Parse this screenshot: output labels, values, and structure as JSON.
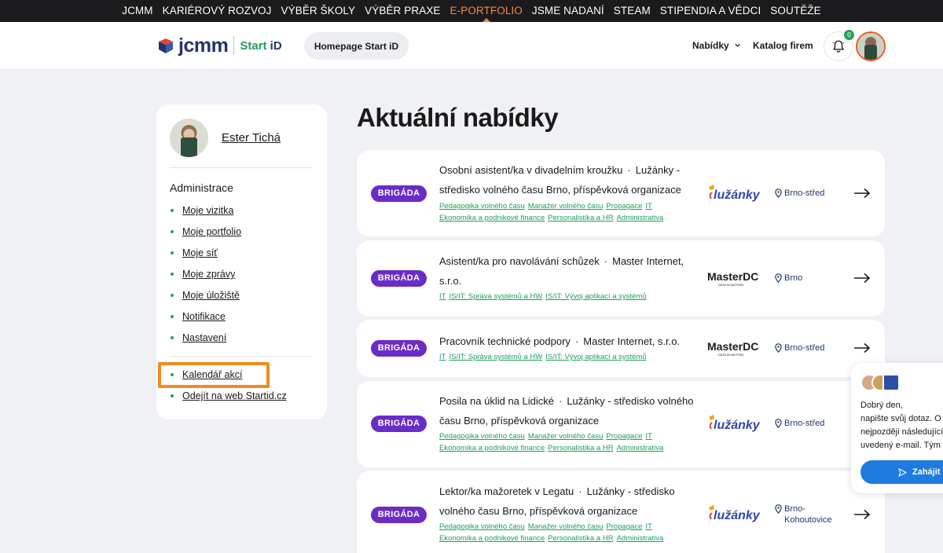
{
  "topnav": {
    "items": [
      "JCMM",
      "KARIÉROVÝ ROZVOJ",
      "VÝBĚR ŠKOLY",
      "VÝBĚR PRAXE",
      "E-PORTFOLIO",
      "JSME NADANÍ",
      "STEAM",
      "STIPENDIA A VĚDCI",
      "SOUTĚŽE"
    ],
    "active_index": 4
  },
  "header": {
    "logo_text": "jcmm",
    "logo_sub_a": "Start",
    "logo_sub_b": "iD",
    "home_button": "Homepage Start iD",
    "nav_offers": "Nabídky",
    "nav_catalog": "Katalog firem",
    "notification_count": "0"
  },
  "sidebar": {
    "user_name": "Ester Tichá",
    "heading": "Administrace",
    "links": [
      "Moje vizitka",
      "Moje portfolio",
      "Moje síť",
      "Moje zprávy",
      "Moje úložiště",
      "Notifikace",
      "Nastavení"
    ],
    "extra_links": [
      "Kalendář akcí",
      "Odejít na web Startid.cz"
    ]
  },
  "main": {
    "title": "Aktuální nabídky",
    "offers": [
      {
        "badge": "BRIGÁDA",
        "title": "Osobní asistent/ka v divadelním kroužku",
        "sep": "·",
        "company": "Lužánky - středisko volného času Brno, příspěvková organizace",
        "tags": [
          "Pedagogika volného času",
          "Manažer volného času",
          "Propagace",
          "IT",
          "Ekonomika a podnikové finance",
          "Personalistika a HR",
          "Administrativa"
        ],
        "logo": "lužánky",
        "location": "Brno-střed"
      },
      {
        "badge": "BRIGÁDA",
        "title": "Asistent/ka pro navolávání schůzek",
        "sep": "·",
        "company": "Master Internet, s.r.o.",
        "tags": [
          "IT",
          "IS/IT: Správa systémů a HW",
          "IS/IT: Vývoj aplikací a systémů"
        ],
        "logo": "MasterDC",
        "logo_sub": "DATA IN MOTION",
        "location": "Brno"
      },
      {
        "badge": "BRIGÁDA",
        "title": "Pracovník technické podpory",
        "sep": "·",
        "company": "Master Internet, s.r.o.",
        "tags": [
          "IT",
          "IS/IT: Správa systémů a HW",
          "IS/IT: Vývoj aplikací a systémů"
        ],
        "logo": "MasterDC",
        "logo_sub": "DATA IN MOTION",
        "location": "Brno-střed"
      },
      {
        "badge": "BRIGÁDA",
        "title": "Posila na úklid na Lidické",
        "sep": "·",
        "company": "Lužánky - středisko volného času Brno, příspěvková organizace",
        "tags": [
          "Pedagogika volného času",
          "Manažer volného času",
          "Propagace",
          "IT",
          "Ekonomika a podnikové finance",
          "Personalistika a HR",
          "Administrativa"
        ],
        "logo": "lužánky",
        "location": "Brno-střed"
      },
      {
        "badge": "BRIGÁDA",
        "title": "Lektor/ka mažoretek v Legatu",
        "sep": "·",
        "company": "Lužánky - středisko volného času Brno, příspěvková organizace",
        "tags": [
          "Pedagogika volného času",
          "Manažer volného času",
          "Propagace",
          "IT",
          "Ekonomika a podnikové finance",
          "Personalistika a HR",
          "Administrativa"
        ],
        "logo": "lužánky",
        "location": "Brno-Kohoutovice"
      }
    ]
  },
  "chat": {
    "line1": "Dobrý den,",
    "line2": "napište svůj dotaz. O",
    "line3": "nejpozději následující",
    "line4": "uvedený e-mail. Tým",
    "button": "Zahájit"
  },
  "colors": {
    "accent_orange": "#f08a3c",
    "badge_purple": "#6a2cc7",
    "tag_green": "#1f9e5a",
    "navy": "#21356b",
    "chat_blue": "#1e7be0"
  }
}
